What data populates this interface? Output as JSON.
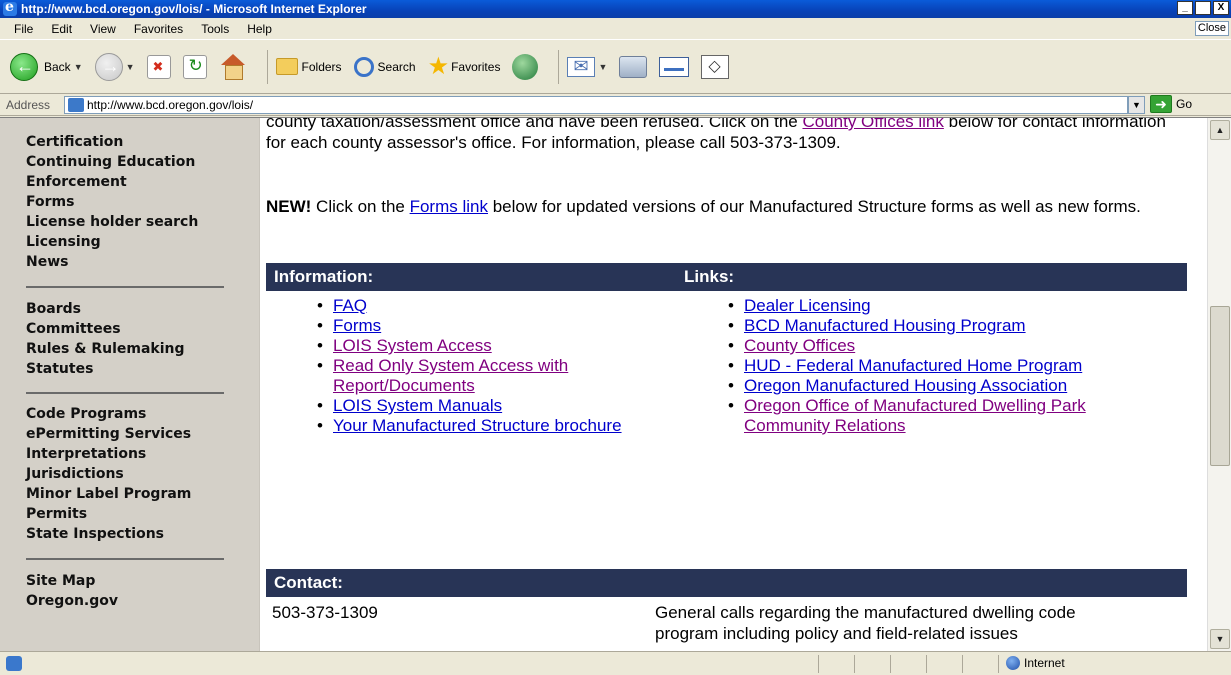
{
  "window": {
    "title": "http://www.bcd.oregon.gov/lois/ - Microsoft Internet Explorer",
    "min": "_",
    "max": " ",
    "close": "X"
  },
  "menu": {
    "items": [
      "File",
      "Edit",
      "View",
      "Favorites",
      "Tools",
      "Help"
    ],
    "close_label": "Close"
  },
  "toolbar": {
    "back": "Back",
    "folders": "Folders",
    "search": "Search",
    "favorites": "Favorites"
  },
  "address": {
    "label": "Address",
    "url": "http://www.bcd.oregon.gov/lois/",
    "go": "Go"
  },
  "sidebar": {
    "group1": [
      "Certification",
      "Continuing Education",
      "Enforcement",
      "Forms",
      "License holder search",
      "Licensing",
      "News"
    ],
    "group2": [
      "Boards",
      "Committees",
      "Rules & Rulemaking",
      "Statutes"
    ],
    "group3": [
      "Code Programs",
      "ePermitting Services",
      "Interpretations",
      "Jurisdictions",
      "Minor Label Program",
      "Permits",
      "State Inspections"
    ],
    "group4": [
      "Site Map",
      "Oregon.gov"
    ]
  },
  "main": {
    "para1_pre": "county taxation/assessment office and have been refused. Click on the ",
    "para1_link": "County Offices link",
    "para1_post": " below for contact information for each county assessor's office. For information, please call 503-373-1309.",
    "para2_new": "NEW!",
    "para2_pre": " Click on the ",
    "para2_link": "Forms link",
    "para2_post": " below for updated versions of our Manufactured Structure forms as well as new forms.",
    "information_heading": "Information:",
    "links_heading": "Links:",
    "info_links": [
      "FAQ",
      "Forms",
      "LOIS System Access",
      "Read Only System Access with Report/Documents",
      "LOIS System Manuals",
      "Your Manufactured Structure brochure"
    ],
    "links_links": [
      "Dealer Licensing",
      "BCD Manufactured Housing Program",
      "County Offices",
      "HUD - Federal Manufactured Home Program",
      "Oregon Manufactured Housing Association",
      "Oregon Office of Manufactured Dwelling Park Community Relations"
    ],
    "contact_heading": "Contact:",
    "contact_phone": "503-373-1309",
    "contact_desc": "General calls regarding the manufactured dwelling code program including policy and field-related issues"
  },
  "status": {
    "zone": "Internet"
  }
}
